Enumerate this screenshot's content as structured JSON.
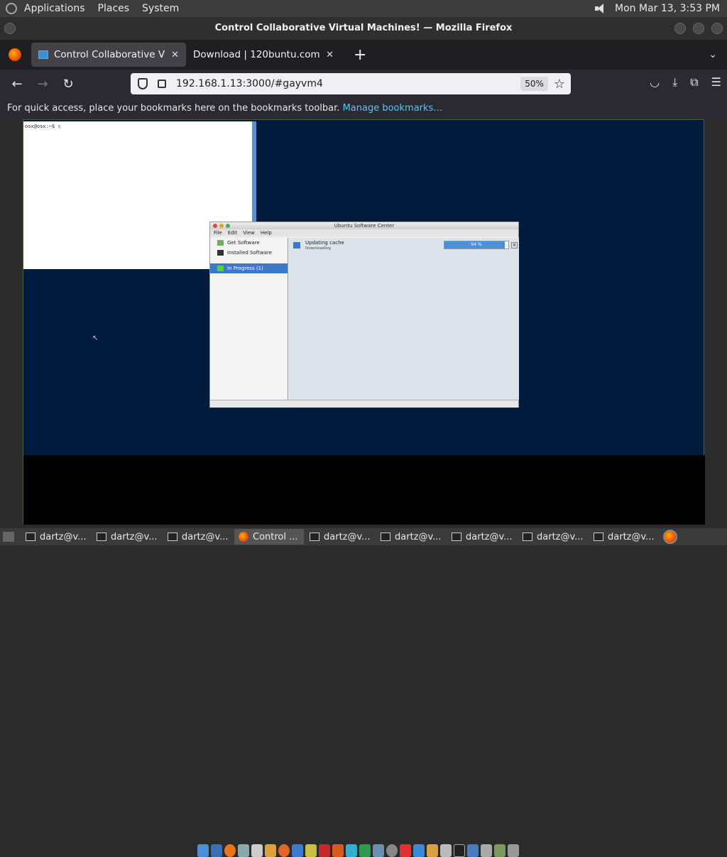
{
  "top_panel": {
    "menus": [
      "Applications",
      "Places",
      "System"
    ],
    "clock": "Mon Mar 13,  3:53 PM"
  },
  "window": {
    "title": "Control Collaborative Virtual Machines! — Mozilla Firefox"
  },
  "tabs": [
    {
      "title": "Control Collaborative Virtual Machines!",
      "display": "Control Collaborative Virtua",
      "active": true
    },
    {
      "title": "Download | 120buntu.com",
      "display": "Download | 120buntu.com",
      "active": false
    }
  ],
  "navbar": {
    "url": "192.168.1.13:3000/#gayvm4",
    "zoom": "50%"
  },
  "bookmarks_bar": {
    "text": "For quick access, place your bookmarks here on the bookmarks toolbar.",
    "link": "Manage bookmarks…"
  },
  "vm": {
    "terminal_prompt": "osx@osx:~$ ",
    "software_center": {
      "title": "Ubuntu Software Center",
      "menus": [
        "File",
        "Edit",
        "View",
        "Help"
      ],
      "sidebar": [
        "Get Software",
        "Installed Software",
        "In Progress (1)"
      ],
      "task_title": "Updating cache",
      "task_status": "Downloading",
      "progress_label": "94 %",
      "progress": 0.94
    }
  },
  "taskbar": {
    "items": [
      {
        "label": "dartz@v...",
        "type": "terminal"
      },
      {
        "label": "dartz@v...",
        "type": "terminal"
      },
      {
        "label": "dartz@v...",
        "type": "terminal"
      },
      {
        "label": "Control ...",
        "type": "firefox",
        "active": true
      },
      {
        "label": "dartz@v...",
        "type": "terminal"
      },
      {
        "label": "dartz@v...",
        "type": "terminal"
      },
      {
        "label": "dartz@v...",
        "type": "terminal"
      },
      {
        "label": "dartz@v...",
        "type": "terminal"
      },
      {
        "label": "dartz@v...",
        "type": "terminal"
      }
    ]
  }
}
